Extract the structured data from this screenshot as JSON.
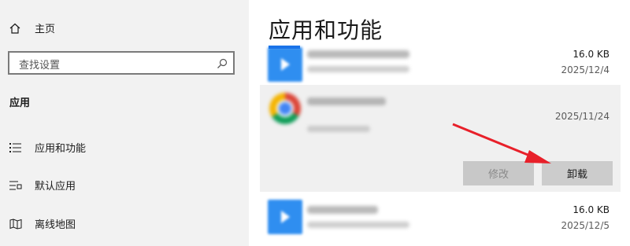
{
  "sidebar": {
    "home_label": "主页",
    "search_placeholder": "查找设置",
    "section_label": "应用",
    "items": [
      {
        "label": "应用和功能",
        "icon": "apps-features-icon"
      },
      {
        "label": "默认应用",
        "icon": "default-apps-icon"
      },
      {
        "label": "离线地图",
        "icon": "offline-maps-icon"
      }
    ]
  },
  "main": {
    "title": "应用和功能",
    "apps": [
      {
        "size": "16.0 KB",
        "date": "2025/12/4"
      },
      {
        "size": "",
        "date": "2025/11/24",
        "selected": true,
        "modify_label": "修改",
        "uninstall_label": "卸载"
      },
      {
        "size": "16.0 KB",
        "date": "2025/12/5"
      }
    ]
  },
  "colors": {
    "accent": "#1a73e8",
    "arrow": "#e8202a",
    "sidebar_bg": "#f2f2f2",
    "selected_row_bg": "#f0f0f0"
  }
}
